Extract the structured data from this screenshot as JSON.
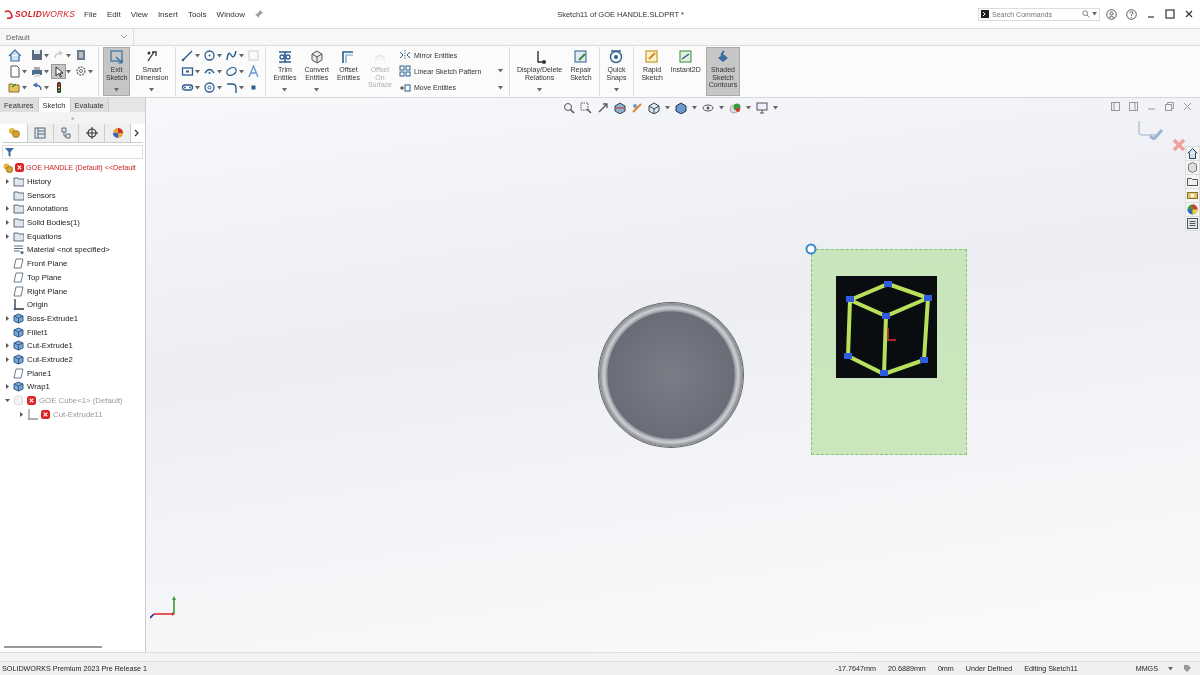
{
  "app": {
    "logo": "**SOLID**WORKS"
  },
  "menu": [
    "File",
    "Edit",
    "View",
    "Insert",
    "Tools",
    "Window"
  ],
  "window": {
    "title": "Sketch11 of GOE HANDLE.SLDPRT *"
  },
  "search": {
    "placeholder": "Search Commands"
  },
  "configuration": {
    "value": "Default"
  },
  "ribbon": [
    {
      "kind": "quick-tools"
    },
    {
      "kind": "separator"
    },
    {
      "kind": "large",
      "label": "Exit Sketch",
      "selected": true,
      "disabled": false,
      "dropdown": true
    },
    {
      "kind": "large",
      "label": "Smart Dimension",
      "selected": false,
      "disabled": false,
      "dropdown": true
    },
    {
      "kind": "separator"
    },
    {
      "kind": "sketch-tools"
    },
    {
      "kind": "separator"
    },
    {
      "kind": "large",
      "label": "Trim Entities",
      "selected": false,
      "disabled": false,
      "dropdown": true
    },
    {
      "kind": "large",
      "label": "Convert Entities",
      "selected": false,
      "disabled": false,
      "dropdown": true
    },
    {
      "kind": "large",
      "label": "Offset Entities",
      "selected": false,
      "disabled": false,
      "dropdown": false
    },
    {
      "kind": "large",
      "label": "Offset On Surface",
      "selected": false,
      "disabled": true,
      "dropdown": false
    },
    {
      "kind": "list",
      "items": [
        {
          "label": "Mirror Entities",
          "dropdown": false
        },
        {
          "label": "Linear Sketch Pattern",
          "dropdown": true
        },
        {
          "label": "Move Entities",
          "dropdown": true
        }
      ]
    },
    {
      "kind": "separator"
    },
    {
      "kind": "large",
      "label": "Display/Delete Relations",
      "selected": false,
      "disabled": false,
      "dropdown": true
    },
    {
      "kind": "large",
      "label": "Repair Sketch",
      "selected": false,
      "disabled": false,
      "dropdown": false
    },
    {
      "kind": "separator"
    },
    {
      "kind": "large",
      "label": "Quick Snaps",
      "selected": false,
      "disabled": false,
      "dropdown": true
    },
    {
      "kind": "separator"
    },
    {
      "kind": "large",
      "label": "Rapid Sketch",
      "selected": false,
      "disabled": false,
      "dropdown": false
    },
    {
      "kind": "large",
      "label": "Instant2D",
      "selected": false,
      "disabled": false,
      "dropdown": false
    },
    {
      "kind": "large",
      "label": "Shaded Sketch Contours",
      "selected": true,
      "disabled": false,
      "dropdown": false
    }
  ],
  "command_tabs": [
    {
      "label": "Features",
      "selected": false
    },
    {
      "label": "Sketch",
      "selected": true
    },
    {
      "label": "Evaluate",
      "selected": false
    }
  ],
  "panel_tabs": [
    {
      "selected": true
    },
    {
      "selected": false
    },
    {
      "selected": false
    },
    {
      "selected": false
    },
    {
      "selected": false
    }
  ],
  "tree": {
    "root": {
      "label": "GOE HANDLE (Default) <<Default",
      "error": true
    },
    "items": [
      {
        "label": "History",
        "kind": "folder",
        "has_children": true,
        "expanded": false,
        "error": false,
        "greyed": false
      },
      {
        "label": "Sensors",
        "kind": "folder",
        "has_children": false,
        "error": false,
        "greyed": false
      },
      {
        "label": "Annotations",
        "kind": "folder",
        "has_children": true,
        "expanded": false,
        "error": false,
        "greyed": false
      },
      {
        "label": "Solid Bodies(1)",
        "kind": "folder",
        "has_children": true,
        "expanded": false,
        "error": false,
        "greyed": false
      },
      {
        "label": "Equations",
        "kind": "folder",
        "has_children": true,
        "expanded": false,
        "error": false,
        "greyed": false
      },
      {
        "label": "Material <not specified>",
        "kind": "material",
        "has_children": false,
        "error": false,
        "greyed": false
      },
      {
        "label": "Front Plane",
        "kind": "plane",
        "has_children": false,
        "error": false,
        "greyed": false
      },
      {
        "label": "Top Plane",
        "kind": "plane",
        "has_children": false,
        "error": false,
        "greyed": false
      },
      {
        "label": "Right Plane",
        "kind": "plane",
        "has_children": false,
        "error": false,
        "greyed": false
      },
      {
        "label": "Origin",
        "kind": "origin",
        "has_children": false,
        "error": false,
        "greyed": false
      },
      {
        "label": "Boss-Extrude1",
        "kind": "feature",
        "has_children": true,
        "expanded": false,
        "error": false,
        "greyed": false
      },
      {
        "label": "Fillet1",
        "kind": "feature",
        "has_children": false,
        "error": false,
        "greyed": false
      },
      {
        "label": "Cut-Extrude1",
        "kind": "feature",
        "has_children": true,
        "expanded": false,
        "error": false,
        "greyed": false
      },
      {
        "label": "Cut-Extrude2",
        "kind": "feature",
        "has_children": true,
        "expanded": false,
        "error": false,
        "greyed": false
      },
      {
        "label": "Plane1",
        "kind": "plane",
        "has_children": false,
        "error": false,
        "greyed": false
      },
      {
        "label": "Wrap1",
        "kind": "feature",
        "has_children": true,
        "expanded": false,
        "error": false,
        "greyed": false
      },
      {
        "label": "GOE Cube<1> (Default)",
        "kind": "part",
        "has_children": true,
        "expanded": true,
        "error": true,
        "greyed": true,
        "children": [
          {
            "label": "Cut-Extrude11",
            "kind": "origin",
            "has_children": true,
            "expanded": false,
            "error": true,
            "greyed": true
          }
        ]
      }
    ]
  },
  "status_bar": {
    "product": "SOLIDWORKS Premium 2023 Pre Release 1",
    "x": "-17.7647mm",
    "y": "20.6889mm",
    "z": "0mm",
    "sketch_state": "Under Defined",
    "mode": "Editing Sketch11",
    "units": "MMGS"
  }
}
